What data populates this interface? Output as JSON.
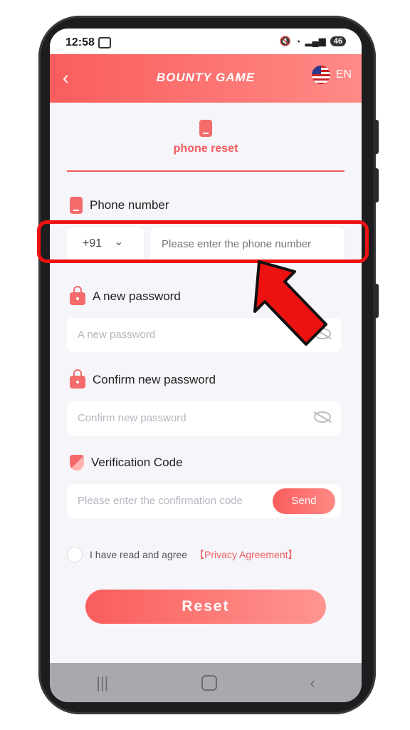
{
  "status_bar": {
    "time": "12:58",
    "battery": "46"
  },
  "header": {
    "back_icon": "back-chevron-icon",
    "brand": "BOUNTY GAME",
    "language": "EN",
    "flag_icon": "us-flag-icon"
  },
  "tab": {
    "label": "phone reset",
    "icon": "phone-icon"
  },
  "phone_section": {
    "label": "Phone number",
    "country_code": "+91",
    "placeholder": "Please enter the phone number"
  },
  "new_password": {
    "label": "A new password",
    "placeholder": "A new password"
  },
  "confirm_password": {
    "label": "Confirm new password",
    "placeholder": "Confirm new password"
  },
  "verification": {
    "label": "Verification Code",
    "placeholder": "Please enter the confirmation code",
    "send": "Send"
  },
  "agreement": {
    "text": "I have read and agree",
    "link": "【Privacy Agreement】"
  },
  "reset_button": "Reset",
  "nav": {
    "recents": "|||",
    "back": "‹"
  },
  "colors": {
    "accent": "#f95d5d",
    "highlight": "#ee1111"
  }
}
